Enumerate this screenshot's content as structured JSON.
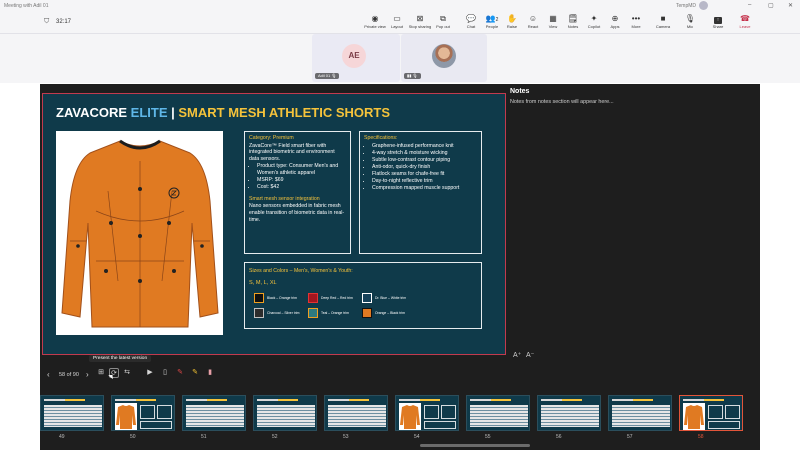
{
  "window": {
    "title": "Meeting with Adil 01",
    "user": "TempMD",
    "controls": [
      "–",
      "▢",
      "✕"
    ]
  },
  "toolbar": {
    "timer": "32:17",
    "items": [
      {
        "label": "Private view",
        "icon": "◉"
      },
      {
        "label": "Layout",
        "icon": "▭"
      },
      {
        "label": "Stop sharing",
        "icon": "⊠"
      },
      {
        "label": "Pop out",
        "icon": "⧉"
      },
      {
        "label": "Chat",
        "icon": "💬"
      },
      {
        "label": "People",
        "icon": "👥",
        "badge": "2"
      },
      {
        "label": "Raise",
        "icon": "✋"
      },
      {
        "label": "React",
        "icon": "☺"
      },
      {
        "label": "View",
        "icon": "▦"
      },
      {
        "label": "Notes",
        "icon": "🗒"
      },
      {
        "label": "Copilot",
        "icon": "✦"
      },
      {
        "label": "Apps",
        "icon": "⊕"
      },
      {
        "label": "More",
        "icon": "•••"
      },
      {
        "label": "Camera",
        "icon": "■"
      },
      {
        "label": "Mic",
        "icon": "🎙"
      },
      {
        "label": "Share",
        "icon": "↑"
      },
      {
        "label": "Leave",
        "icon": "☎"
      }
    ]
  },
  "participants": [
    {
      "initials": "AE",
      "name": "Adil 01"
    },
    {
      "initials": "",
      "name": ""
    }
  ],
  "slide": {
    "title_brand": "ZAVACORE",
    "title_accent": "ELITE",
    "title_sep": "|",
    "title_product": "SMART MESH ATHLETIC SHORTS",
    "category_header": "Category: Premium",
    "category_desc": "ZavaCore™ Field smart fiber with integrated biometric and environment data sensors.",
    "category_bullets": [
      "Product type: Consumer Men's and Women's athletic apparel",
      "MSRP: $69",
      "Cost: $42"
    ],
    "sensor_header": "Smart mesh sensor integration",
    "sensor_desc": "Nano sensors embedded in fabric mesh enable transition of biometric data in real-time.",
    "specs_header": "Specifications:",
    "specs": [
      "Graphene-infused performance knit",
      "4-way stretch & moisture wicking",
      "Subtle low-contrast contour piping",
      "Anti-odor, quick-dry finish",
      "Flatlock seams for chafe-free fit",
      "Day-to-night reflective trim",
      "Compression mapped muscle support"
    ],
    "colors_header": "Sizes and Colors – Men's, Women's & Youth:",
    "sizes": "S, M, L, XL",
    "swatches": [
      {
        "label": "Black – Orange trim",
        "fill": "#111111",
        "trim": "#f0a020"
      },
      {
        "label": "Deep Red – Red trim",
        "fill": "#a3161f",
        "trim": "#e23333"
      },
      {
        "label": "Dr. Blue – White trim",
        "fill": "#16425a",
        "trim": "#ffffff"
      },
      {
        "label": "Charcoal – Silver trim",
        "fill": "#2c2c2c",
        "trim": "#c0c0c0"
      },
      {
        "label": "Teal – Orange trim",
        "fill": "#2d7a80",
        "trim": "#f0a020"
      },
      {
        "label": "Orange – Black trim",
        "fill": "#e07a22",
        "trim": "#111111"
      }
    ]
  },
  "notes": {
    "title": "Notes",
    "placeholder": "Notes from notes section will appear here..."
  },
  "font_controls": {
    "increase": "A⁺",
    "decrease": "A⁻"
  },
  "presenter_controls": {
    "prev_icon": "‹",
    "page_indicator": "58 of 90",
    "next_icon": "›",
    "tooltip": "Present the latest version"
  },
  "thumbnails": [
    {
      "num": "49",
      "kind": "table"
    },
    {
      "num": "50",
      "kind": "product"
    },
    {
      "num": "51",
      "kind": "table"
    },
    {
      "num": "52",
      "kind": "table"
    },
    {
      "num": "53",
      "kind": "table"
    },
    {
      "num": "54",
      "kind": "product"
    },
    {
      "num": "55",
      "kind": "table"
    },
    {
      "num": "56",
      "kind": "table"
    },
    {
      "num": "57",
      "kind": "table"
    },
    {
      "num": "58",
      "kind": "product",
      "current": true
    }
  ],
  "colors": {
    "slide_bg": "#0f3a4a",
    "accent_yellow": "#f5c33b",
    "accent_blue": "#5fb7e8",
    "leave_red": "#c4314b",
    "shirt": "#e07a22"
  }
}
